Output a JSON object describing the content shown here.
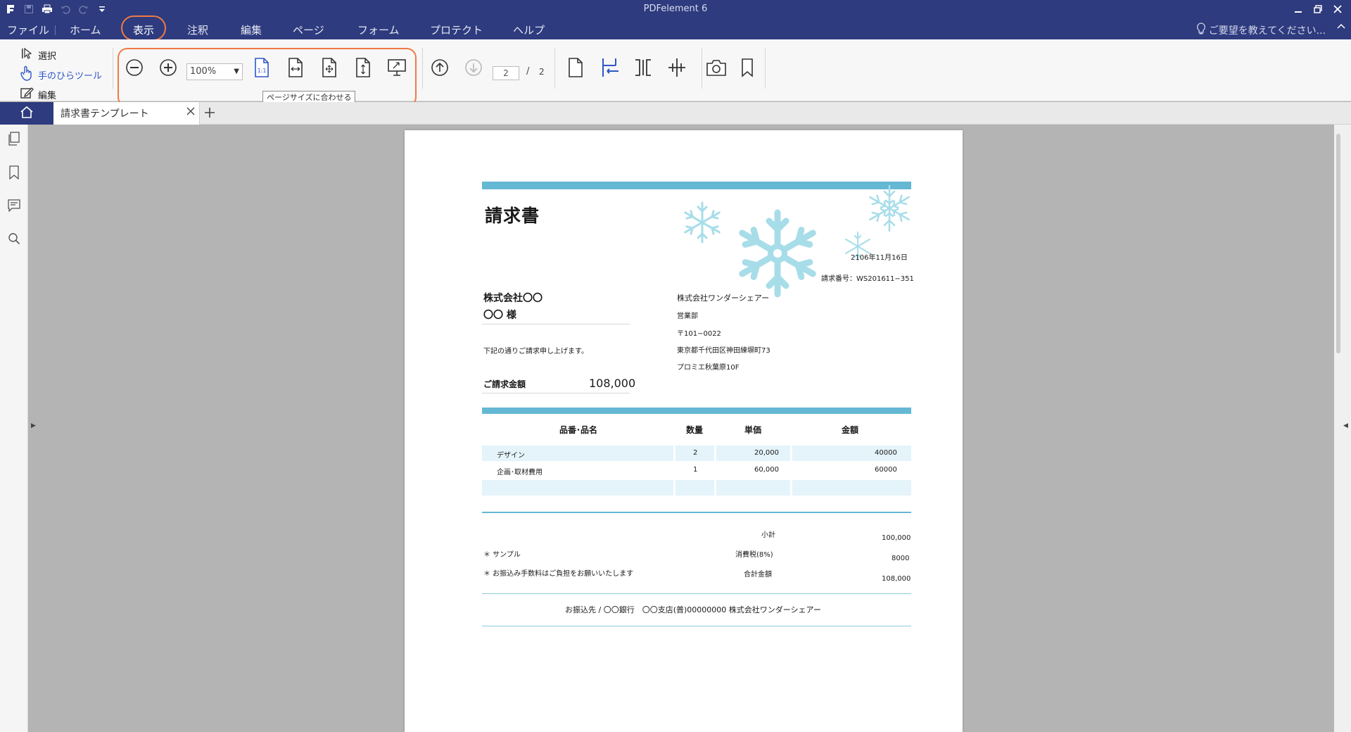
{
  "app": {
    "title": "PDFelement 6"
  },
  "menu": {
    "items": [
      "ファイル",
      "ホーム",
      "表示",
      "注釈",
      "編集",
      "ページ",
      "フォーム",
      "プロテクト",
      "ヘルプ"
    ],
    "active": "表示",
    "help_search": "ご要望を教えてください..."
  },
  "toolbar": {
    "select_label": "選択",
    "hand_label": "手のひらツール",
    "edit_label": "編集",
    "zoom_value": "100%",
    "tooltip": "ページサイズに合わせる",
    "current_page": "2",
    "page_separator": "/",
    "total_pages": "2"
  },
  "tabs": {
    "document_tab": "請求書テンプレート"
  },
  "colors": {
    "titlebar": "#2e3b7e",
    "accent_blue": "#64b8d4",
    "highlight_orange": "#f07a45",
    "row_bg": "#e4f4fa"
  },
  "invoice": {
    "title": "請求書",
    "date": "2106年11月16日",
    "invoice_number": "請求番号：WS201611−351",
    "customer_company": "株式会社〇〇",
    "customer_name": "〇〇 様",
    "intro": "下記の通りご請求申し上げます。",
    "amount_label": "ご請求金額",
    "amount_value": "108,000",
    "sender": {
      "company": "株式会社ワンダーシェアー",
      "department": "営業部",
      "postal": "〒101−0022",
      "address": "東京都千代田区神田練塀町73",
      "building": "プロミエ秋葉原10F"
    },
    "table": {
      "headers": [
        "品番･品名",
        "数量",
        "単価",
        "金額"
      ],
      "rows": [
        [
          "デザイン",
          "2",
          "20,000",
          "40000"
        ],
        [
          "企画･取材費用",
          "1",
          "60,000",
          "60000"
        ]
      ]
    },
    "notes": [
      "＊ サンプル",
      "＊ お振込み手数料はご負担をお願いいたします"
    ],
    "totals": {
      "subtotal_label": "小計",
      "subtotal_value": "100,000",
      "tax_label": "消費税(8%)",
      "tax_value": "8000",
      "total_label": "合計金額",
      "total_value": "108,000"
    },
    "bank": "お振込先 / 〇〇銀行　〇〇支店(普)00000000 株式会社ワンダーシェアー"
  }
}
